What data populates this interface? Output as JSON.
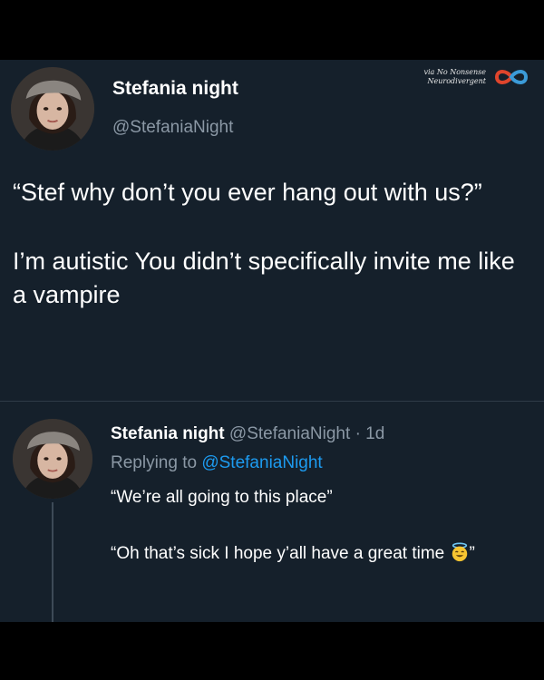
{
  "watermark": {
    "line1": "via No Nonsense",
    "line2": "Neurodivergent",
    "icon": "infinity-icon",
    "colors": [
      "#e0452c",
      "#3b9bd8"
    ]
  },
  "main_tweet": {
    "name": "Stefania night",
    "handle": "@StefaniaNight",
    "paragraph1": "“Stef why don’t you ever hang out with us?”",
    "paragraph2": "I’m autistic You didn’t specifically invite me like a vampire"
  },
  "reply_tweet": {
    "name": "Stefania night",
    "handle": "@StefaniaNight",
    "separator": "·",
    "time": "1d",
    "replying_prefix": "Replying to",
    "replying_handle": "@StefaniaNight",
    "line1": "“We’re all going to this place”",
    "line2_text": "“Oh that’s sick I hope y’all have a great time",
    "line2_close": "”",
    "emoji": "smiling-face-with-halo-icon"
  },
  "colors": {
    "background": "#15202b",
    "link": "#1d9bf0",
    "secondary_text": "#8b98a5"
  }
}
